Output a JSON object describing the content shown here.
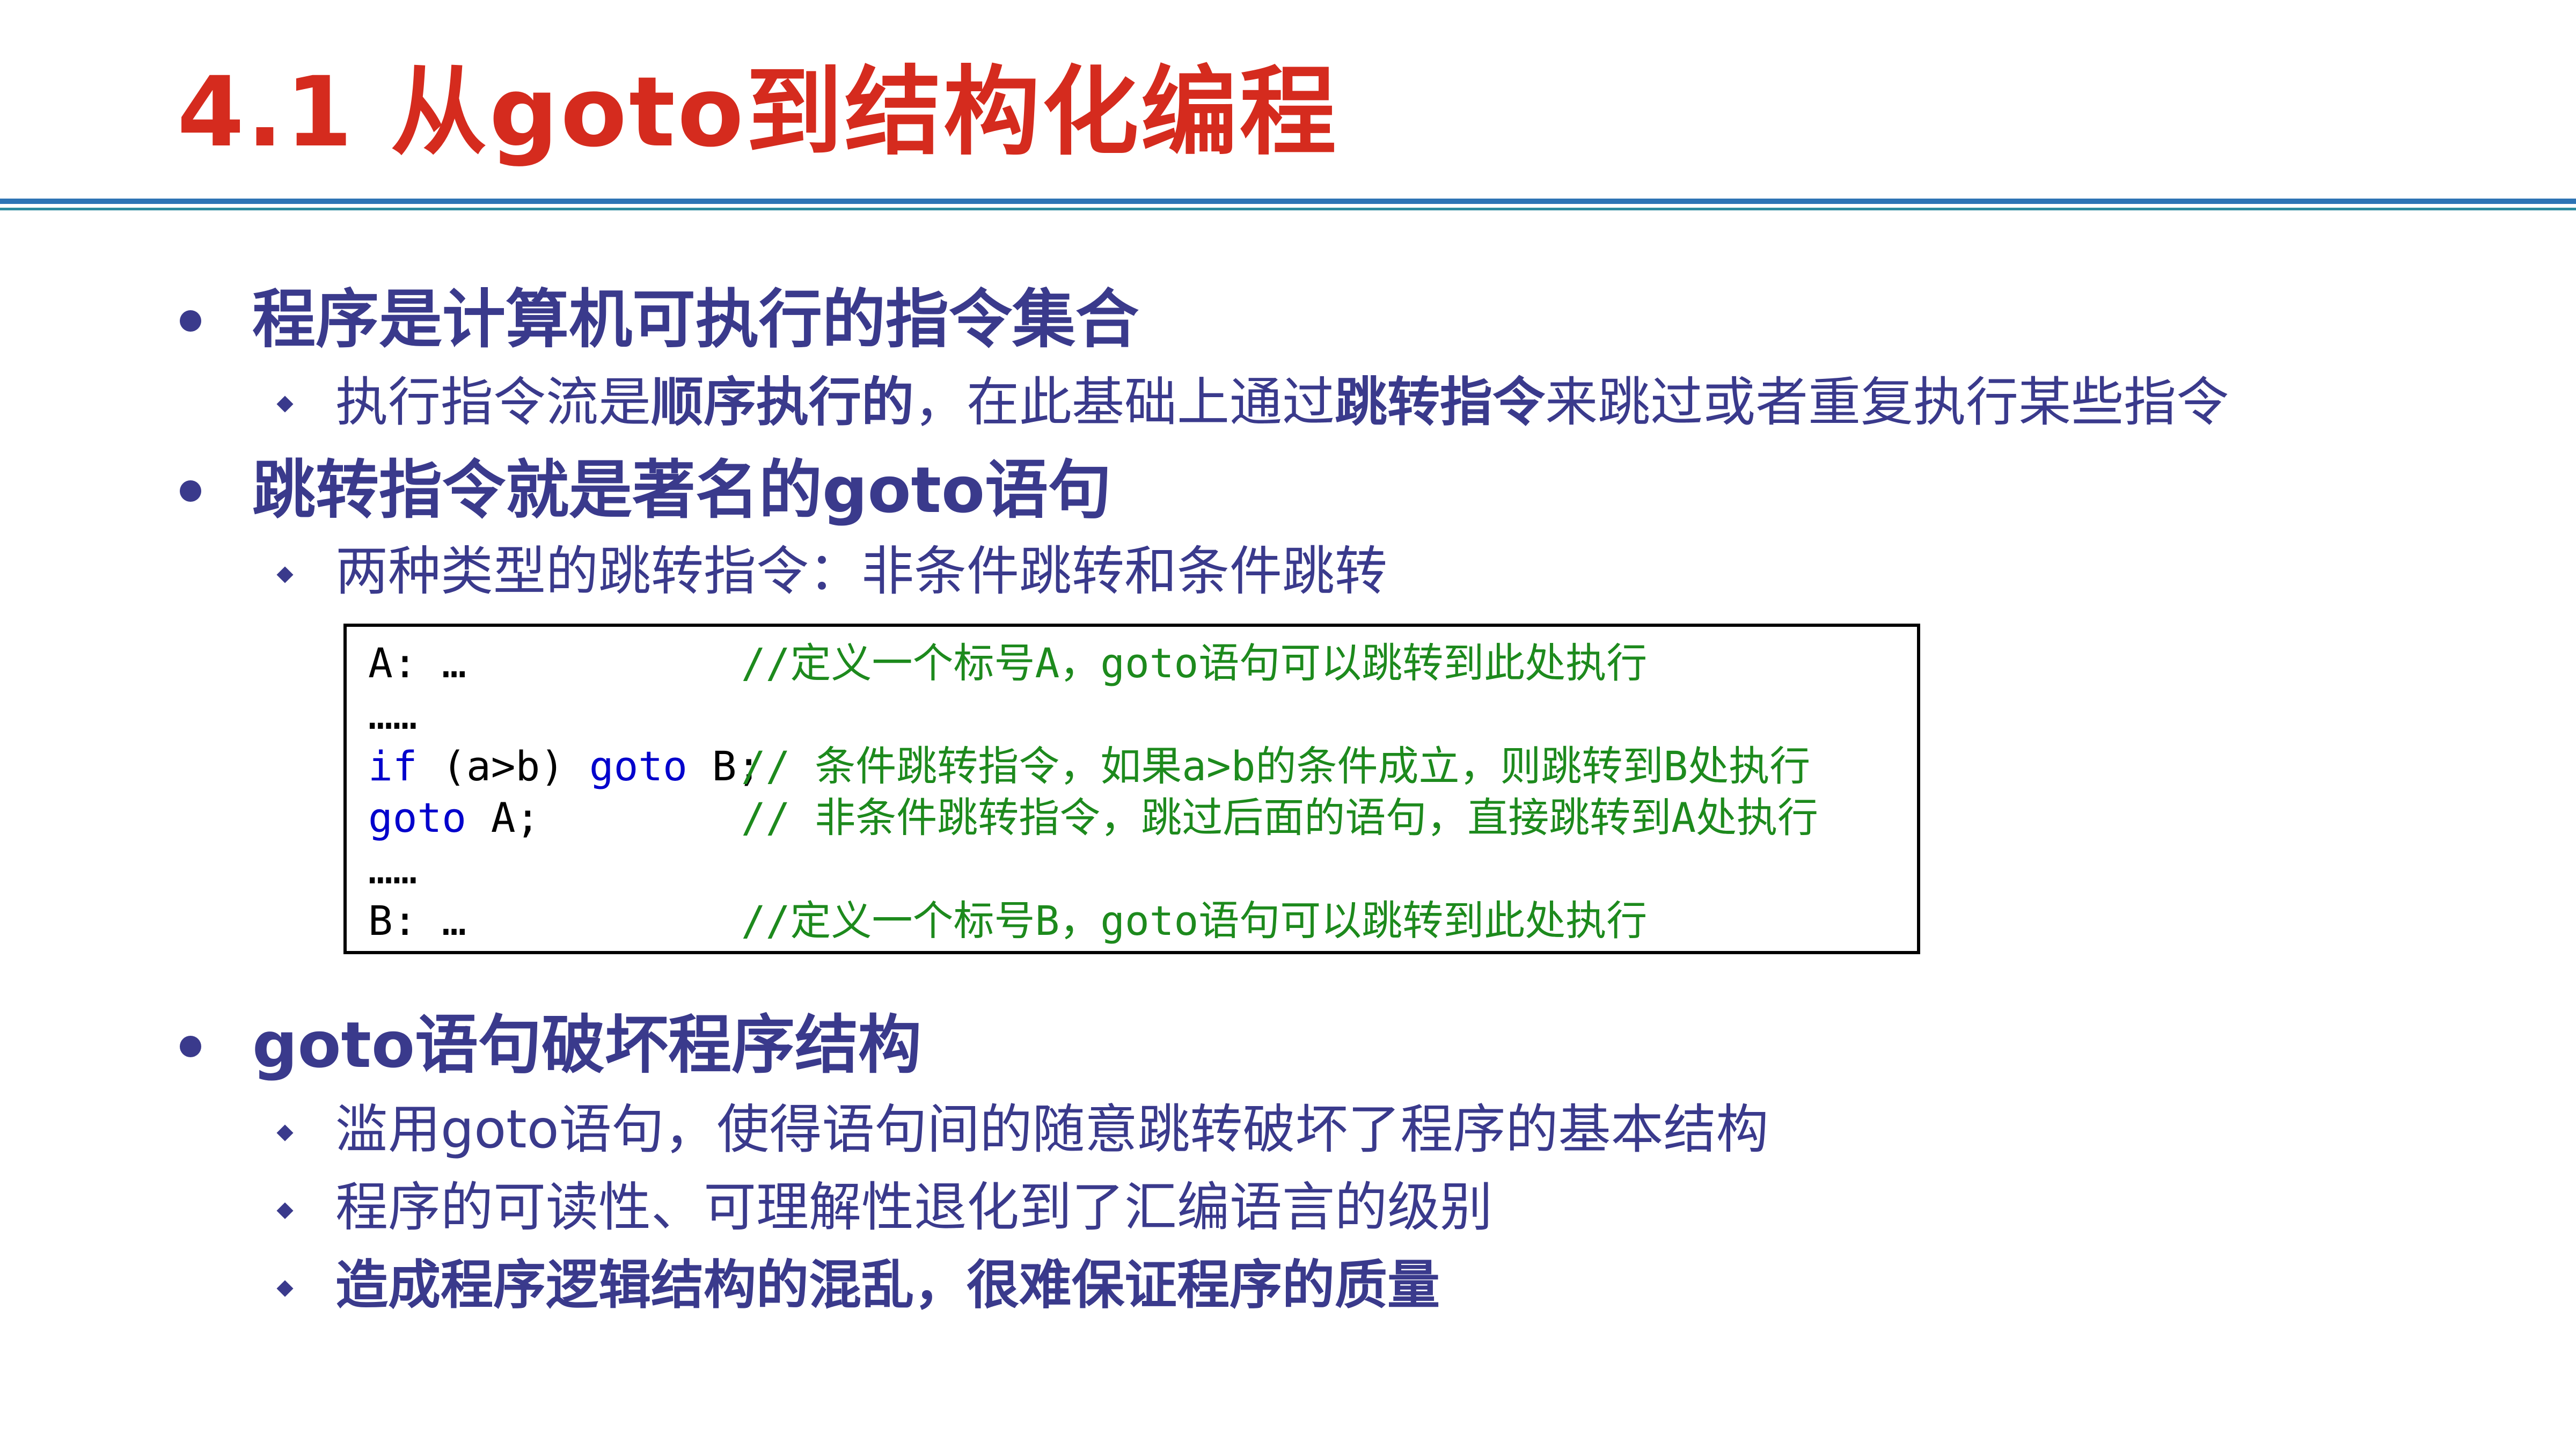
{
  "title": "4.1 从goto到结构化编程",
  "bullets": [
    {
      "text": "程序是计算机可执行的指令集合",
      "subs": [
        {
          "p1": "执行指令流是",
          "b1": "顺序执行的",
          "p2": "，在此基础上通过",
          "b2": "跳转指令",
          "p3": "来跳过或者重复执行某些指令"
        }
      ]
    },
    {
      "text": "跳转指令就是著名的goto语句",
      "subs": [
        {
          "text": "两种类型的跳转指令：非条件跳转和条件跳转"
        }
      ]
    },
    {
      "text": "goto语句破坏程序结构",
      "subs": [
        {
          "text": "滥用goto语句，使得语句间的随意跳转破坏了程序的基本结构"
        },
        {
          "text": "程序的可读性、可理解性退化到了汇编语言的级别"
        },
        {
          "text": "造成程序逻辑结构的混乱，很难保证程序的质量"
        }
      ]
    }
  ],
  "code": {
    "lines": [
      {
        "label": "A: …",
        "comment": "//定义一个标号A，goto语句可以跳转到此处执行"
      },
      {
        "label": "……",
        "comment": ""
      },
      {
        "kw1": "if",
        "mid1": " (a>b) ",
        "kw2": "goto",
        "mid2": " B;",
        "comment": "// 条件跳转指令，如果a>b的条件成立，则跳转到B处执行"
      },
      {
        "kw1": "goto",
        "mid1": " A;",
        "comment": "// 非条件跳转指令，跳过后面的语句，直接跳转到A处执行"
      },
      {
        "label": "……",
        "comment": ""
      },
      {
        "label": "B: …",
        "comment": "//定义一个标号B，goto语句可以跳转到此处执行"
      }
    ]
  },
  "colors": {
    "title": "#D52B1E",
    "text": "#3A3A8C",
    "code_comment": "#1D8A1D",
    "code_keyword": "#0000CC",
    "rule": "#2E74B5"
  }
}
